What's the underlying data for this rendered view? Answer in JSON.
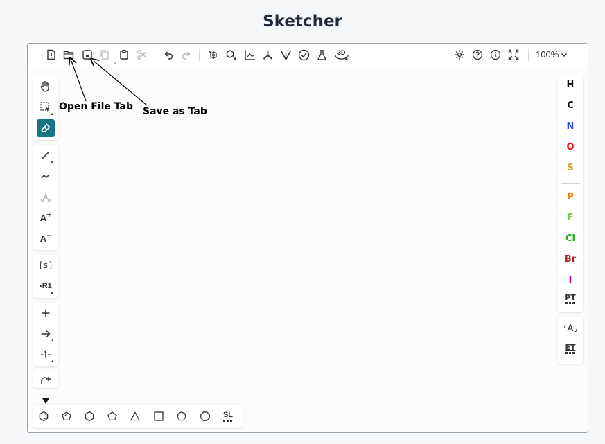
{
  "page": {
    "title": "Sketcher"
  },
  "toolbar": {
    "zoom": "100%",
    "threeD_label": "3D"
  },
  "annotations": {
    "open_file": "Open File Tab",
    "save_as": "Save as Tab"
  },
  "left_toolbar": {
    "sgroup_label": "[s]",
    "rgroup_label": "R1",
    "charge_plus_label": "A",
    "charge_minus_label": "A"
  },
  "right_toolbar": {
    "atoms": [
      {
        "symbol": "H",
        "color": "#111111"
      },
      {
        "symbol": "C",
        "color": "#111111"
      },
      {
        "symbol": "N",
        "color": "#3050f8"
      },
      {
        "symbol": "O",
        "color": "#ff0d0d"
      },
      {
        "symbol": "S",
        "color": "#c9a227"
      },
      {
        "symbol": "P",
        "color": "#ff8000"
      },
      {
        "symbol": "F",
        "color": "#78d04a"
      },
      {
        "symbol": "Cl",
        "color": "#1fb01f"
      },
      {
        "symbol": "Br",
        "color": "#a62929"
      },
      {
        "symbol": "I",
        "color": "#940094"
      }
    ],
    "periodic_table_label": "PT",
    "extended_table_label": "ET",
    "any_atom_label": "A"
  },
  "bottom_toolbar": {
    "structure_library_label": "SL"
  },
  "colors": {
    "accent": "#167782"
  }
}
